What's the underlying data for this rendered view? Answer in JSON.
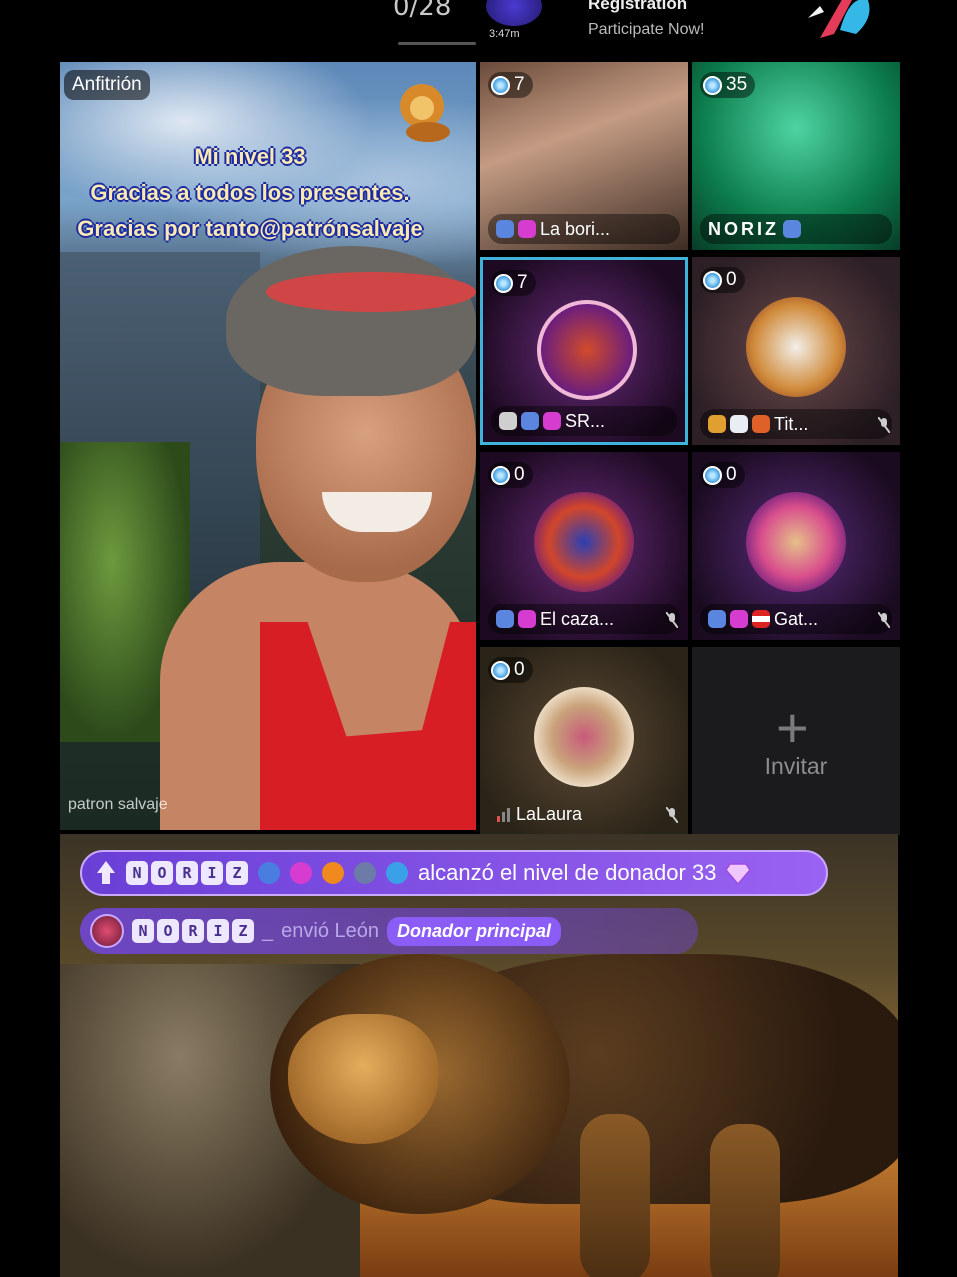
{
  "topbar": {
    "progress": "0/28",
    "timer": "3:47m",
    "registration_title": "Registration",
    "registration_sub": "Participate Now!"
  },
  "host": {
    "label": "Anfitrión",
    "overlay_lines": [
      "Mi nivel 33",
      "Gracias a todos los presentes.",
      "Gracias por tanto@patrónsalvaje"
    ],
    "name": "patron salvaje"
  },
  "seats": [
    {
      "count": "7",
      "name": "La bori..."
    },
    {
      "count": "35",
      "name": "NORIZ"
    },
    {
      "count": "7",
      "name": "SR..."
    },
    {
      "count": "0",
      "name": "Tit..."
    },
    {
      "count": "0",
      "name": "El caza..."
    },
    {
      "count": "0",
      "name": "Gat..."
    },
    {
      "count": "0",
      "name": "LaLaura"
    }
  ],
  "invite_label": "Invitar",
  "notices": {
    "level_user_letters": [
      "N",
      "O",
      "R",
      "I",
      "Z"
    ],
    "level_text": "alcanzó el nivel de donador 33",
    "gift_user_suffix": "_",
    "gift_text": "envió León",
    "gift_tag": "Donador principal"
  },
  "colors": {
    "accent_purple": "#8b5cf6",
    "active_seat_border": "#3fb3d9",
    "overlay_text": "#fbe9b4",
    "overlay_outline": "#1b2aa0"
  }
}
